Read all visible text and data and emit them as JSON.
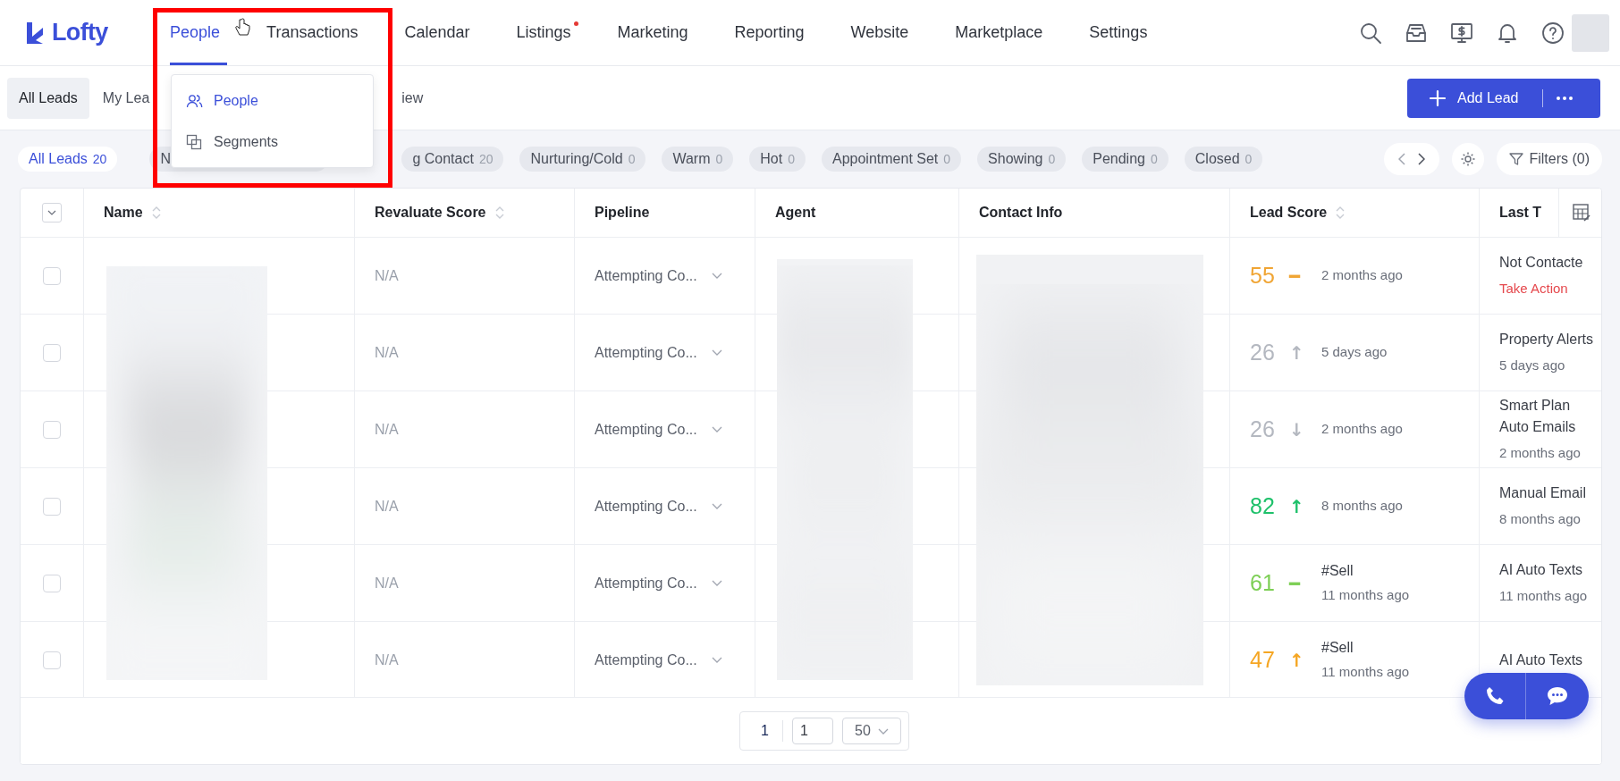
{
  "nav": {
    "logo": "Lofty",
    "items": [
      {
        "label": "People",
        "selected": true,
        "dot": false
      },
      {
        "label": "Transactions",
        "selected": false,
        "dot": false
      },
      {
        "label": "Calendar",
        "selected": false,
        "dot": false
      },
      {
        "label": "Listings",
        "selected": false,
        "dot": true
      },
      {
        "label": "Marketing",
        "selected": false,
        "dot": false
      },
      {
        "label": "Reporting",
        "selected": false,
        "dot": false
      },
      {
        "label": "Website",
        "selected": false,
        "dot": false
      },
      {
        "label": "Marketplace",
        "selected": false,
        "dot": false
      },
      {
        "label": "Settings",
        "selected": false,
        "dot": false
      }
    ]
  },
  "nav_dropdown": {
    "items": [
      {
        "label": "People",
        "kind": "people",
        "selected": true
      },
      {
        "label": "Segments",
        "kind": "segments",
        "selected": false
      }
    ]
  },
  "view_tabs": [
    {
      "label": "All Leads",
      "selected": true
    },
    {
      "label": "My Lea",
      "selected": false
    },
    {
      "label": "iew",
      "selected": false
    }
  ],
  "add_lead": {
    "label": "Add Lead"
  },
  "stage_chips": [
    {
      "label": "All Leads",
      "count": "20",
      "selected": true
    },
    {
      "label": "N",
      "selected": false
    },
    {
      "label": "g Contact",
      "count": "20",
      "selected": false
    },
    {
      "label": "Nurturing/Cold",
      "count": "0",
      "selected": false
    },
    {
      "label": "Warm",
      "count": "0",
      "selected": false
    },
    {
      "label": "Hot",
      "count": "0",
      "selected": false
    },
    {
      "label": "Appointment Set",
      "count": "0",
      "selected": false
    },
    {
      "label": "Showing",
      "count": "0",
      "selected": false
    },
    {
      "label": "Pending",
      "count": "0",
      "selected": false
    },
    {
      "label": "Closed",
      "count": "0",
      "selected": false
    }
  ],
  "filters": {
    "label": "Filters (0)"
  },
  "table": {
    "columns": [
      {
        "label": "Name",
        "sortable": true
      },
      {
        "label": "Revaluate Score",
        "sortable": true
      },
      {
        "label": "Pipeline",
        "sortable": false
      },
      {
        "label": "Agent",
        "sortable": false
      },
      {
        "label": "Contact Info",
        "sortable": false
      },
      {
        "label": "Lead Score",
        "sortable": true
      },
      {
        "label": "Last T",
        "sortable": false
      }
    ],
    "rows": [
      {
        "checked": false,
        "revaluate": "N/A",
        "pipeline": "Attempting Co...",
        "score": "55",
        "color": "#f0a534",
        "trend": "━",
        "time": "2 months ago",
        "last_touch": {
          "title": "Not Contacte",
          "detail": "Take Action",
          "link": true
        }
      },
      {
        "checked": false,
        "revaluate": "N/A",
        "pipeline": "Attempting Co...",
        "score": "26",
        "color": "#b4b8c0",
        "trend": "↑",
        "time": "5 days ago",
        "last_touch": {
          "title": "Property Alerts",
          "detail": "5 days ago",
          "link": false
        }
      },
      {
        "checked": false,
        "revaluate": "N/A",
        "pipeline": "Attempting Co...",
        "score": "26",
        "color": "#b4b8c0",
        "trend": "↓",
        "time": "2 months ago",
        "last_touch": {
          "title": "Smart Plan Auto Emails",
          "detail": "2 months ago",
          "link": false
        }
      },
      {
        "checked": false,
        "revaluate": "N/A",
        "pipeline": "Attempting Co...",
        "score": "82",
        "color": "#1fc16b",
        "trend": "↑",
        "time": "8 months ago",
        "last_touch": {
          "title": "Manual Email",
          "detail": "8 months ago",
          "link": false
        }
      },
      {
        "checked": false,
        "revaluate": "N/A",
        "pipeline": "Attempting Co...",
        "score": "61",
        "color": "#7dcf55",
        "trend": "━",
        "tag": "#Sell",
        "time": "11 months ago",
        "last_touch": {
          "title": "AI Auto Texts",
          "detail": "11 months ago",
          "link": false
        }
      },
      {
        "checked": false,
        "revaluate": "N/A",
        "pipeline": "Attempting Co...",
        "score": "47",
        "color": "#f5a623",
        "trend": "↑",
        "tag": "#Sell",
        "time": "11 months ago",
        "last_touch": {
          "title": "AI Auto Texts"
        }
      }
    ]
  },
  "pagination": {
    "current": "1",
    "page_input": "1",
    "page_size": "50"
  }
}
